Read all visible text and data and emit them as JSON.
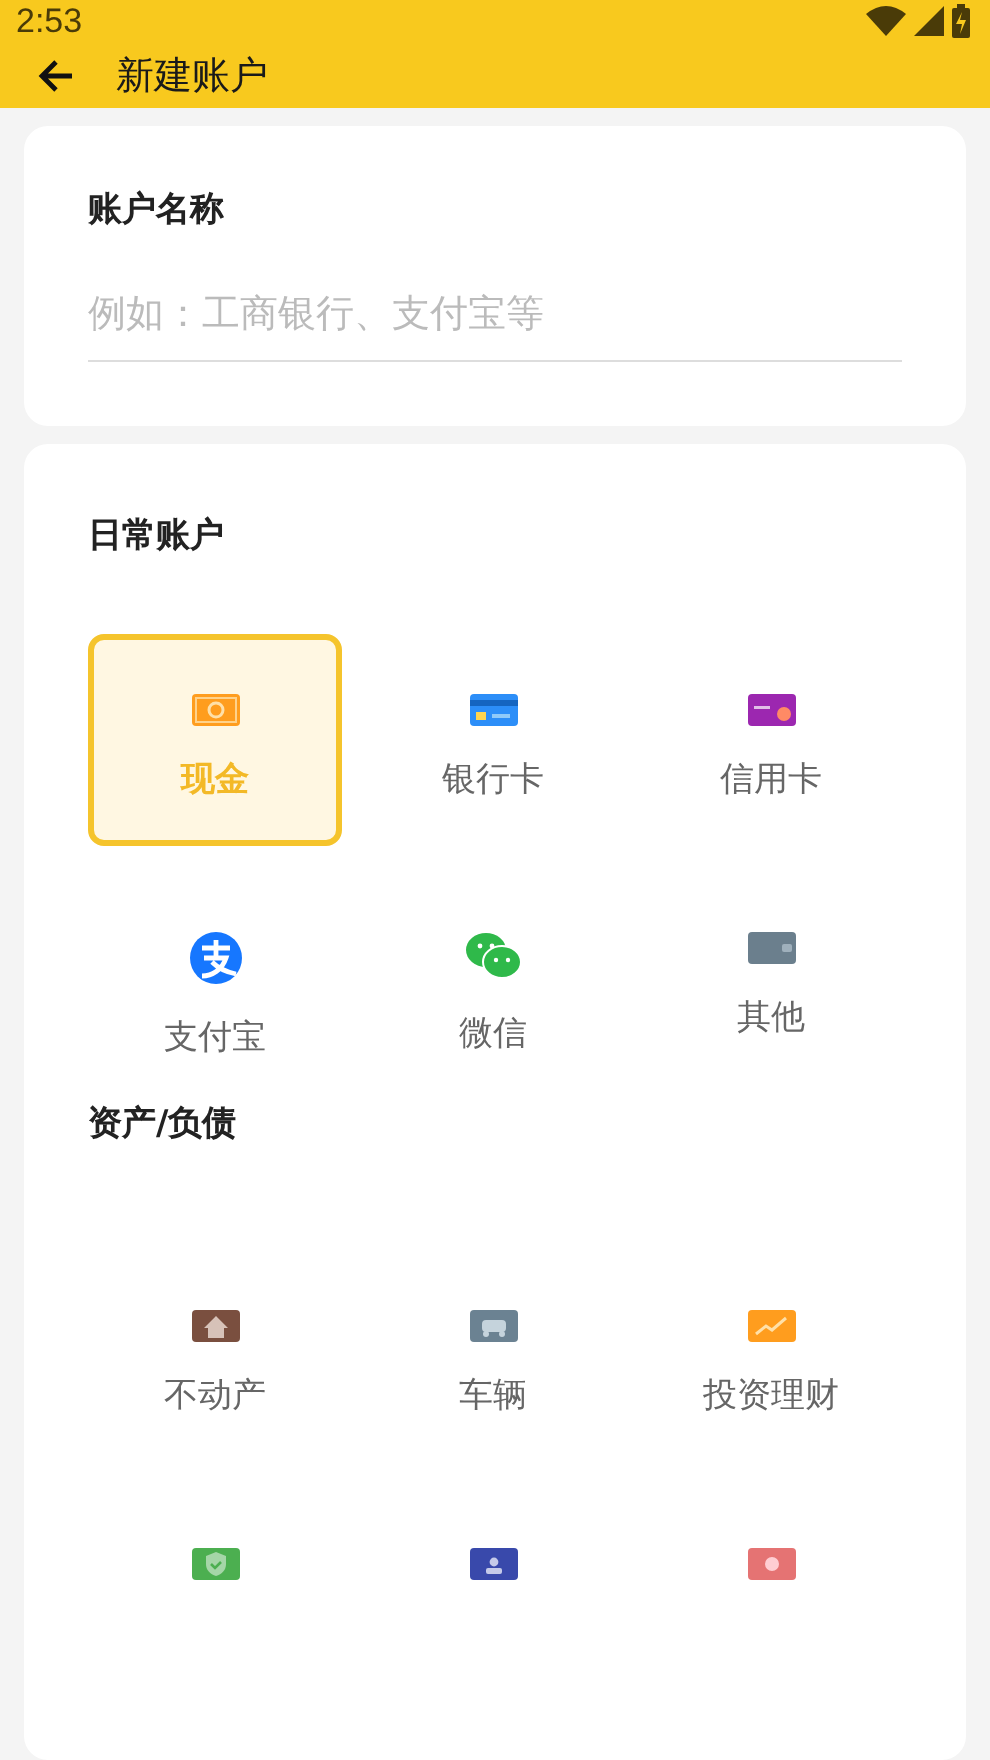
{
  "status_bar": {
    "time": "2:53"
  },
  "app_bar": {
    "title": "新建账户"
  },
  "name_card": {
    "label": "账户名称",
    "placeholder": "例如：工商银行、支付宝等"
  },
  "sections": [
    {
      "title": "日常账户",
      "items": [
        {
          "label": "现金",
          "selected": true
        },
        {
          "label": "银行卡",
          "selected": false
        },
        {
          "label": "信用卡",
          "selected": false
        },
        {
          "label": "支付宝",
          "selected": false
        },
        {
          "label": "微信",
          "selected": false
        },
        {
          "label": "其他",
          "selected": false
        }
      ]
    },
    {
      "title": "资产/负债",
      "items": [
        {
          "label": "不动产",
          "selected": false
        },
        {
          "label": "车辆",
          "selected": false
        },
        {
          "label": "投资理财",
          "selected": false
        },
        {
          "selected": false
        },
        {
          "selected": false
        },
        {
          "selected": false
        }
      ]
    }
  ]
}
